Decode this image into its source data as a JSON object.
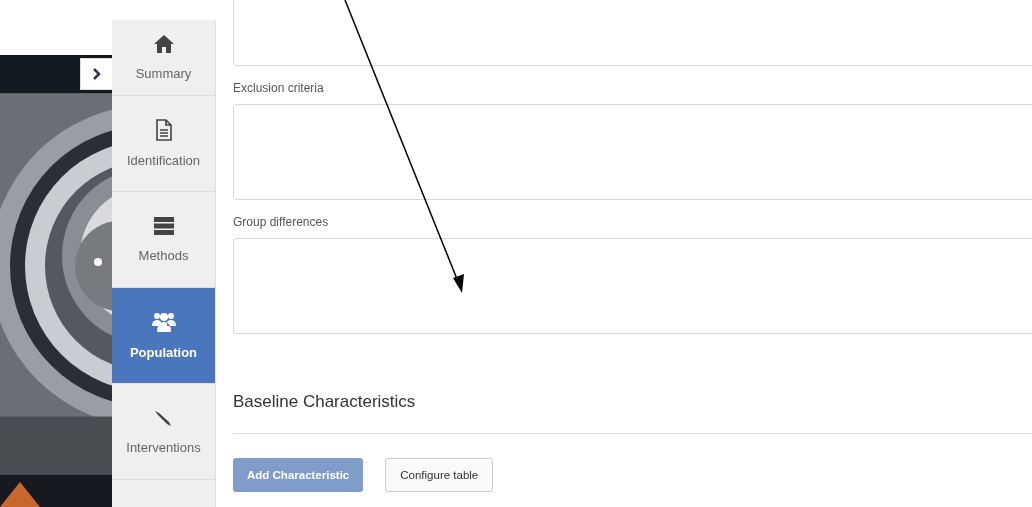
{
  "nav": [
    {
      "label": "Summary",
      "selected": false
    },
    {
      "label": "Identification",
      "selected": false
    },
    {
      "label": "Methods",
      "selected": false
    },
    {
      "label": "Population",
      "selected": true
    },
    {
      "label": "Interventions",
      "selected": false
    }
  ],
  "fields": [
    {
      "kind": "textarea"
    },
    {
      "kind": "textarea",
      "label": "Exclusion criteria"
    },
    {
      "kind": "textarea",
      "label": "Group differences"
    }
  ],
  "section": {
    "heading": "Baseline Characteristics",
    "buttons": [
      {
        "label": "Add Characteristic",
        "kind": "primary"
      },
      {
        "label": "Configure table",
        "kind": "secondary"
      }
    ]
  },
  "annotation": {
    "kind": "arrow"
  }
}
